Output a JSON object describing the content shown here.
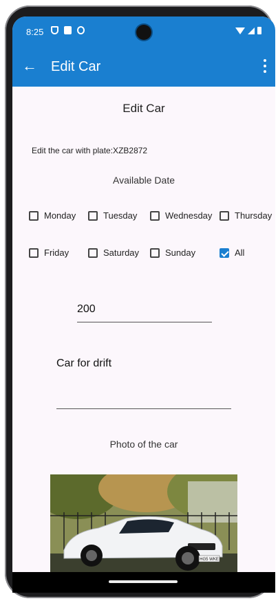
{
  "status_bar": {
    "time": "8:25"
  },
  "app_bar": {
    "title": "Edit Car",
    "back_icon": "←"
  },
  "form": {
    "heading": "Edit Car",
    "plate_text": "Edit the car with plate:XZB2872",
    "available_date_label": "Available Date",
    "days": [
      {
        "label": "Monday",
        "checked": false
      },
      {
        "label": "Tuesday",
        "checked": false
      },
      {
        "label": "Wednesday",
        "checked": false
      },
      {
        "label": "Thursday",
        "checked": false
      },
      {
        "label": "Friday",
        "checked": false
      },
      {
        "label": "Saturday",
        "checked": false
      },
      {
        "label": "Sunday",
        "checked": false
      },
      {
        "label": "All",
        "checked": true
      }
    ],
    "price_value": "200",
    "description_value": "Car for drift",
    "photo_label": "Photo of the car",
    "plate_on_photo": "HG5 WKE"
  },
  "colors": {
    "accent": "#1a7fd0",
    "background": "#fcf7fc"
  }
}
